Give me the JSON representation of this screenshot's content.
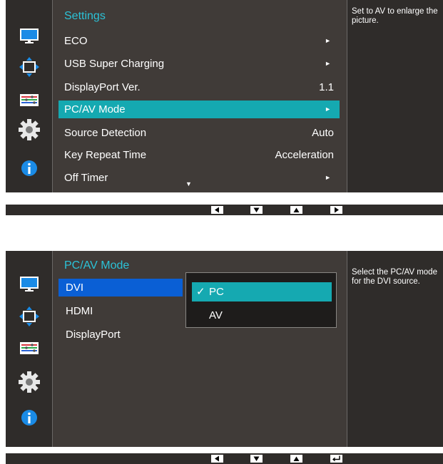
{
  "screen1": {
    "title": "Settings",
    "items": [
      {
        "label": "ECO",
        "value": "►"
      },
      {
        "label": "USB Super Charging",
        "value": "►"
      },
      {
        "label": "DisplayPort Ver.",
        "value": "1.1"
      },
      {
        "label": "PC/AV Mode",
        "value": "►",
        "selected": true
      },
      {
        "label": "Source Detection",
        "value": "Auto"
      },
      {
        "label": "Key Repeat Time",
        "value": "Acceleration"
      },
      {
        "label": "Off Timer",
        "value": "►"
      }
    ],
    "more_indicator": "▼",
    "help": "Set to AV to enlarge the picture."
  },
  "screen2": {
    "title": "PC/AV Mode",
    "items": [
      {
        "label": "DVI",
        "selected": true
      },
      {
        "label": "HDMI"
      },
      {
        "label": "DisplayPort"
      }
    ],
    "options": [
      {
        "label": "PC",
        "check": "✓",
        "selected": true
      },
      {
        "label": "AV"
      }
    ],
    "help": "Select the PC/AV mode for the DVI source."
  },
  "sidebar_icons": [
    "picture-icon",
    "position-icon",
    "color-icon",
    "settings-gear-icon",
    "information-icon"
  ],
  "colors": {
    "accent": "#15a9b1",
    "title": "#2bc2d7",
    "focus_blue": "#0a5fd5",
    "background": "#403b38"
  }
}
